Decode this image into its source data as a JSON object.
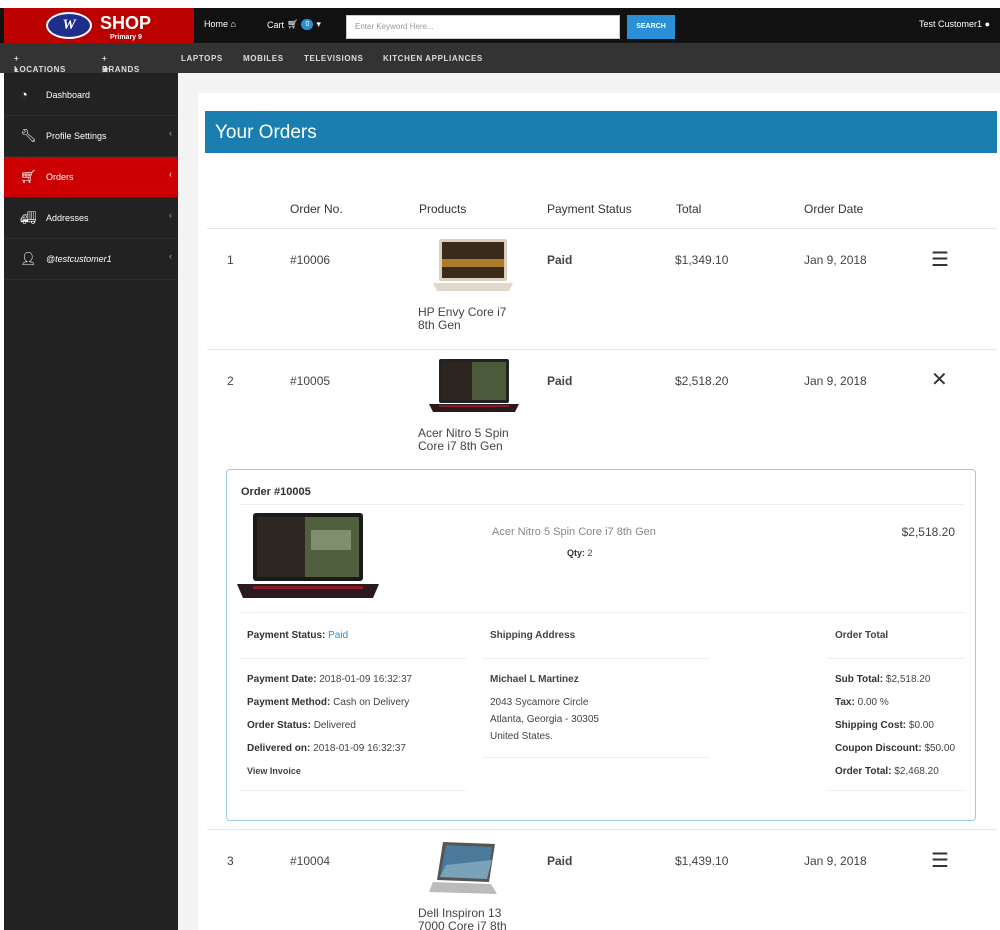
{
  "header": {
    "logo_text": "SHOP",
    "logo_sub": "Primary 9",
    "logo_mark": "W",
    "home_label": "Home",
    "cart_label": "Cart",
    "cart_count": "0",
    "search_placeholder": "Enter Keyword Here...",
    "search_button": "SEARCH",
    "user_label": "Test Customer1"
  },
  "categories": [
    "LOCATIONS",
    "BRANDS",
    "LAPTOPS",
    "MOBILES",
    "TELEVISIONS",
    "KITCHEN APPLIANCES"
  ],
  "sidebar": {
    "items": [
      {
        "label": "Dashboard",
        "icon": "dashboard-icon"
      },
      {
        "label": "Profile Settings",
        "icon": "wrench-icon"
      },
      {
        "label": "Orders",
        "icon": "cart-icon"
      },
      {
        "label": "Addresses",
        "icon": "truck-icon"
      },
      {
        "label": "@testcustomer1",
        "icon": "user-icon"
      }
    ]
  },
  "page_title": "Your Orders",
  "table": {
    "headers": [
      "Order No.",
      "Products",
      "Payment Status",
      "Total",
      "Order Date"
    ],
    "rows": [
      {
        "index": "1",
        "order_no": "#10006",
        "product": "HP Envy Core i7 8th Gen",
        "status": "Paid",
        "total": "$1,349.10",
        "date": "Jan 9, 2018"
      },
      {
        "index": "2",
        "order_no": "#10005",
        "product": "Acer Nitro 5 Spin Core i7 8th Gen",
        "status": "Paid",
        "total": "$2,518.20",
        "date": "Jan 9, 2018"
      },
      {
        "index": "3",
        "order_no": "#10004",
        "product": "Dell Inspiron 13 7000 Core i7 8th",
        "status": "Paid",
        "total": "$1,439.10",
        "date": "Jan 9, 2018"
      }
    ]
  },
  "detail": {
    "title": "Order #10005",
    "product_name": "Acer Nitro 5 Spin Core i7 8th Gen",
    "qty_label": "Qty:",
    "qty": "2",
    "price": "$2,518.20",
    "payment_status_label": "Payment Status:",
    "payment_status": "Paid",
    "payment_date_label": "Payment Date:",
    "payment_date": "2018-01-09 16:32:37",
    "payment_method_label": "Payment Method:",
    "payment_method": "Cash on Delivery",
    "order_status_label": "Order Status:",
    "order_status": "Delivered",
    "delivered_on_label": "Delivered on:",
    "delivered_on": "2018-01-09 16:32:37",
    "view_invoice": "View Invoice",
    "shipping_label": "Shipping Address",
    "ship_name": "Michael L Martinez",
    "ship_line1": "2043 Sycamore Circle",
    "ship_line2": "Atlanta, Georgia - 30305",
    "ship_line3": "United States.",
    "order_total_label": "Order Total",
    "sub_total_label": "Sub Total:",
    "sub_total": "$2,518.20",
    "tax_label": "Tax:",
    "tax": "0.00 %",
    "shipping_cost_label": "Shipping Cost:",
    "shipping_cost": "$0.00",
    "coupon_label": "Coupon Discount:",
    "coupon": "$50.00",
    "order_total_row_label": "Order Total:",
    "order_total": "$2,468.20"
  },
  "colors": {
    "brand_red": "#cc0000",
    "accent_blue": "#1a7fb0",
    "link_blue": "#2a8fd6"
  }
}
